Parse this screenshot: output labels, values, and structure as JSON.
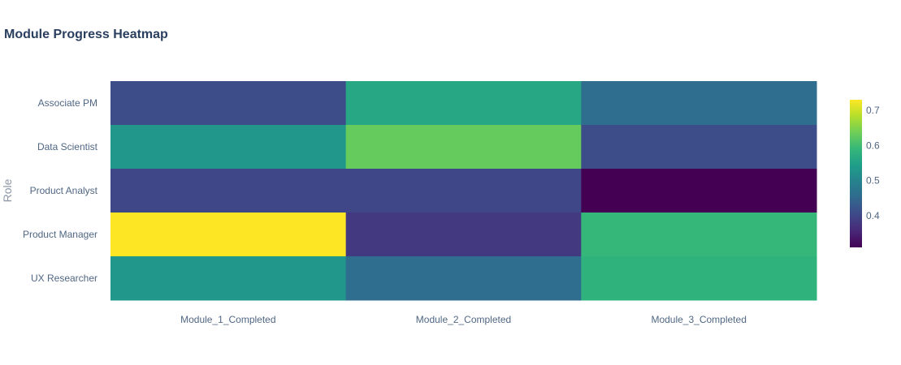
{
  "chart_data": {
    "type": "heatmap",
    "title": "Module Progress Heatmap",
    "xlabel": "",
    "ylabel": "Role",
    "x": [
      "Module_1_Completed",
      "Module_2_Completed",
      "Module_3_Completed"
    ],
    "y": [
      "Associate PM",
      "Data Scientist",
      "Product Analyst",
      "Product Manager",
      "UX Researcher"
    ],
    "z": [
      [
        0.41,
        0.56,
        0.46
      ],
      [
        0.53,
        0.63,
        0.41
      ],
      [
        0.4,
        0.4,
        0.31
      ],
      [
        0.73,
        0.38,
        0.59
      ],
      [
        0.53,
        0.46,
        0.58
      ]
    ],
    "colorscale": "Viridis",
    "zlim": [
      0.31,
      0.73
    ],
    "colorbar": {
      "ticks": [
        0.4,
        0.5,
        0.6,
        0.7
      ],
      "tick_labels": [
        "0.4",
        "0.5",
        "0.6",
        "0.7"
      ]
    },
    "colors": {
      "title": "#2a3f5f",
      "tick_text": "#506784",
      "axis_title": "#8c97a8"
    }
  }
}
